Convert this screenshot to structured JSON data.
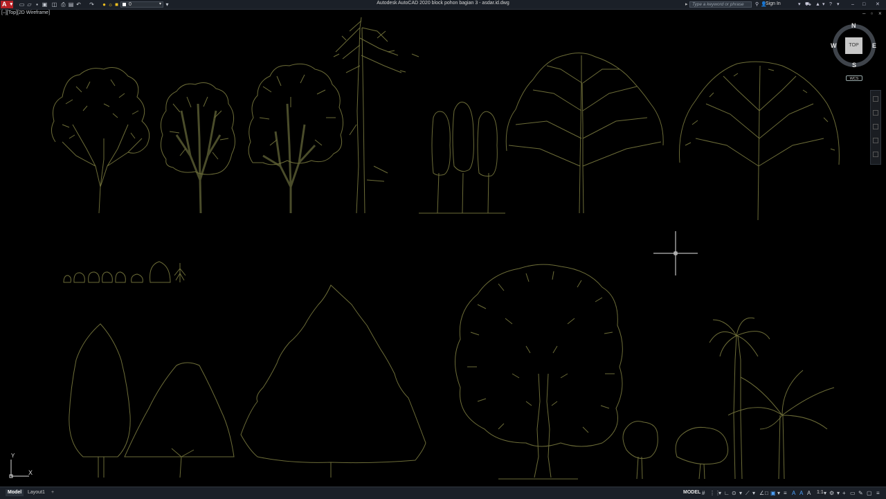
{
  "app": {
    "title": "Autodesk AutoCAD 2020    block pohon bagian 3 - asdar.id.dwg",
    "app_button": "A"
  },
  "quick_access": {
    "icons": [
      "new-icon",
      "open-icon",
      "save-icon",
      "save-as-icon",
      "web-mobile-icon",
      "plot-icon",
      "undo-icon",
      "redo-icon",
      "share-icon"
    ],
    "layer_name": "0"
  },
  "search": {
    "placeholder": "Type a keyword or phrase"
  },
  "account": {
    "sign_in": "Sign In"
  },
  "viewport": {
    "label": "[–][Top][2D Wireframe]"
  },
  "viewcube": {
    "face": "TOP",
    "north": "N",
    "south": "S",
    "east": "E",
    "west": "W",
    "wcs": "WCS"
  },
  "ucs": {
    "x_label": "X",
    "y_label": "Y"
  },
  "tabs": {
    "model": "Model",
    "layout1": "Layout1",
    "add": "+"
  },
  "status": {
    "space": "MODEL",
    "scale": "1:1"
  },
  "colors": {
    "tree_line": "#6d6d38",
    "tree_fill": "#3f4325",
    "background": "#000000",
    "chrome": "#1b2028",
    "app_red": "#b52025"
  }
}
